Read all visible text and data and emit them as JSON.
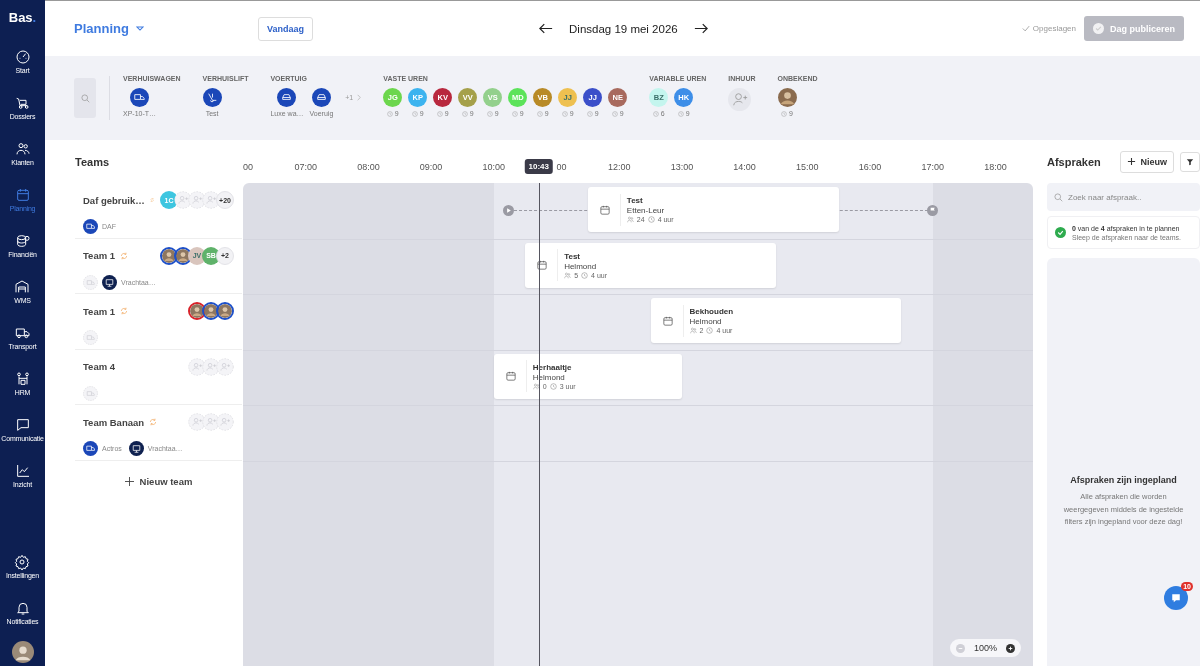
{
  "sidebar": {
    "logo": "Bas",
    "logo_dot": ".",
    "items": [
      {
        "label": "Start",
        "selected": false
      },
      {
        "label": "Dossiers",
        "selected": false
      },
      {
        "label": "Klanten",
        "selected": false
      },
      {
        "label": "Planning",
        "selected": true
      },
      {
        "label": "Financiën",
        "selected": false
      },
      {
        "label": "WMS",
        "selected": false
      },
      {
        "label": "Transport",
        "selected": false
      },
      {
        "label": "HRM",
        "selected": false
      },
      {
        "label": "Communicatie",
        "selected": false
      },
      {
        "label": "Inzicht",
        "selected": false
      }
    ],
    "bottom_items": [
      {
        "label": "Instellingen"
      },
      {
        "label": "Notificaties"
      }
    ]
  },
  "header": {
    "title": "Planning",
    "today": "Vandaag",
    "date": "Dinsdag 19 mei 2026",
    "saved": "Opgeslagen",
    "publish": {
      "label": "Dag publiceren",
      "disabled": true
    }
  },
  "resources": [
    {
      "title": "VERHUISWAGEN",
      "items": [
        {
          "kind": "truck",
          "label": "XP-10-T…"
        }
      ]
    },
    {
      "title": "VERHUISLIFT",
      "items": [
        {
          "kind": "lift",
          "label": "Test"
        }
      ]
    },
    {
      "title": "VOERTUIG",
      "items": [
        {
          "kind": "car",
          "label": "Luxe wa…"
        },
        {
          "kind": "car",
          "label": "Voeruig"
        },
        {
          "kind": "more",
          "label": "+1"
        }
      ]
    },
    {
      "title": "VASTE UREN",
      "items": [
        {
          "kind": "person",
          "initials": "JG",
          "color": "#6cd64d",
          "hours": "9"
        },
        {
          "kind": "person",
          "initials": "KP",
          "color": "#3cb3ef",
          "hours": "9"
        },
        {
          "kind": "person",
          "initials": "KV",
          "color": "#b8283e",
          "hours": "9"
        },
        {
          "kind": "person",
          "initials": "VV",
          "color": "#a5a04a",
          "hours": "9"
        },
        {
          "kind": "person",
          "initials": "VS",
          "color": "#93d08c",
          "hours": "9"
        },
        {
          "kind": "person",
          "initials": "MD",
          "color": "#5ce35a",
          "hours": "9"
        },
        {
          "kind": "person",
          "initials": "VB",
          "color": "#b88a27",
          "hours": "9"
        },
        {
          "kind": "person",
          "initials": "JJ",
          "color": "#eec050",
          "hours": "9"
        },
        {
          "kind": "person",
          "initials": "JJ",
          "color": "#3b4fc9",
          "hours": "9"
        },
        {
          "kind": "person",
          "initials": "NE",
          "color": "#a86a5e",
          "hours": "9"
        }
      ]
    },
    {
      "title": "VARIABLE UREN",
      "items": [
        {
          "kind": "person",
          "initials": "BZ",
          "color": "#c4f5ee",
          "hours": "6"
        },
        {
          "kind": "person",
          "initials": "HK",
          "color": "#3d8ee8",
          "hours": "9"
        }
      ]
    },
    {
      "title": "INHUUR",
      "items": [
        {
          "kind": "add"
        }
      ]
    },
    {
      "title": "ONBEKEND",
      "items": [
        {
          "kind": "photo",
          "hours": "9"
        }
      ]
    }
  ],
  "teams_title": "Teams",
  "hours": [
    "00",
    "07:00",
    "08:00",
    "09:00",
    "10:00",
    "00",
    "12:00",
    "13:00",
    "14:00",
    "15:00",
    "16:00",
    "17:00",
    "18:00"
  ],
  "now": "10:43",
  "teams": [
    {
      "name": "Daf gebruik…",
      "linked": true,
      "members": [
        {
          "kind": "initials",
          "initials": "1C",
          "color": "#3ec6e0"
        },
        {
          "kind": "empty"
        },
        {
          "kind": "empty"
        },
        {
          "kind": "empty"
        },
        {
          "kind": "more",
          "label": "+20"
        }
      ],
      "vehicles": [
        {
          "kind": "truck",
          "label": "DAF"
        }
      ],
      "appointments": [
        {
          "title": "Test",
          "place": "Etten-Leur",
          "people": "24",
          "duration": "4 uur"
        }
      ]
    },
    {
      "name": "Team 1",
      "linked": true,
      "members": [
        {
          "kind": "photo",
          "color": "#1e50c8"
        },
        {
          "kind": "photo",
          "color": "#1e50c8"
        },
        {
          "kind": "initials",
          "initials": "JV",
          "color": "#d9c5bd"
        },
        {
          "kind": "initials",
          "initials": "SB",
          "color": "#5fb26a"
        },
        {
          "kind": "more",
          "label": "+2"
        }
      ],
      "vehicles": [
        {
          "kind": "empty"
        },
        {
          "kind": "screen",
          "label": "Vrachtaa…"
        }
      ],
      "appointments": [
        {
          "title": "Test",
          "place": "Helmond",
          "people": "5",
          "duration": "4 uur"
        }
      ]
    },
    {
      "name": "Team 1",
      "linked": true,
      "members": [
        {
          "kind": "photo",
          "color": "#d8232a"
        },
        {
          "kind": "photo",
          "color": "#1e50c8"
        },
        {
          "kind": "photo",
          "color": "#1e50c8"
        }
      ],
      "vehicles": [
        {
          "kind": "empty"
        }
      ],
      "appointments": [
        {
          "title": "Bekhouden",
          "place": "Helmond",
          "people": "2",
          "duration": "4 uur"
        }
      ]
    },
    {
      "name": "Team 4",
      "linked": false,
      "members": [
        {
          "kind": "empty"
        },
        {
          "kind": "empty"
        },
        {
          "kind": "empty"
        }
      ],
      "vehicles": [
        {
          "kind": "empty"
        }
      ],
      "appointments": [
        {
          "title": "Herhaaltje",
          "place": "Helmond",
          "people": "0",
          "duration": "3 uur"
        }
      ]
    },
    {
      "name": "Team Banaan",
      "linked": true,
      "members": [
        {
          "kind": "empty"
        },
        {
          "kind": "empty"
        },
        {
          "kind": "empty"
        }
      ],
      "vehicles": [
        {
          "kind": "truck",
          "label": "Actros"
        },
        {
          "kind": "screen",
          "label": "Vrachtaa…"
        }
      ]
    }
  ],
  "new_team": "Nieuw team",
  "zoom": "100%",
  "panel": {
    "title": "Afspraken",
    "new": "Nieuw",
    "search_placeholder": "Zoek naar afspraak..",
    "summary": "**0** van de **4** afspraken in te plannen",
    "hint": "Sleep de afspraken naar de teams.",
    "empty_title": "Afspraken zijn ingepland",
    "empty_text": "Alle afspraken die worden weergegeven middels de ingestelde filters zijn ingepland voor deze dag!"
  },
  "chat": {
    "badge": "10"
  }
}
